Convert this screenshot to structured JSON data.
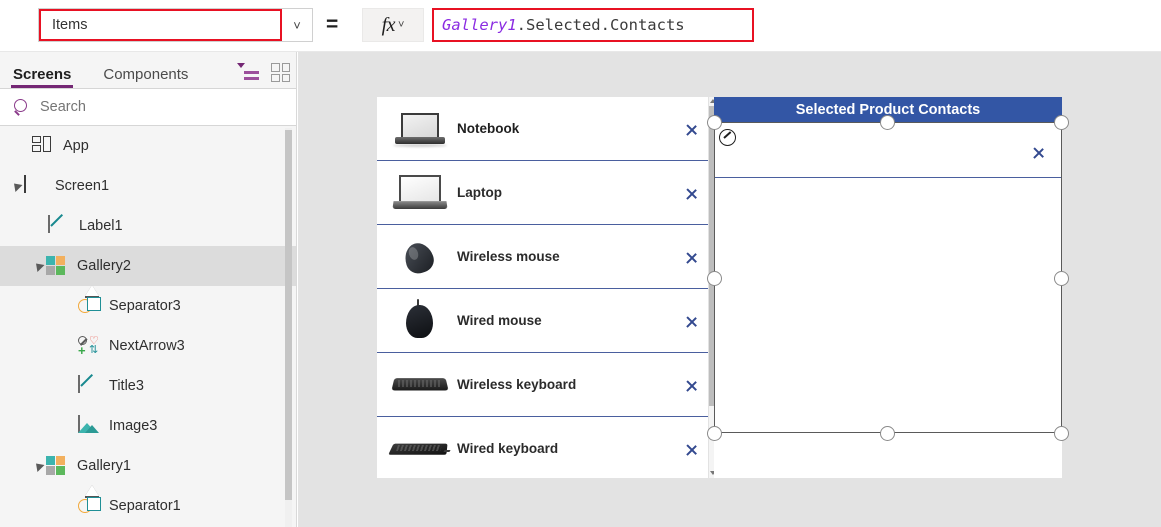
{
  "formula_bar": {
    "property_value": "Items",
    "property_caret_icon": "chevron-down-icon",
    "equals": "=",
    "fx_label": "fx",
    "fx_caret_icon": "chevron-down-icon",
    "formula_identifier": "Gallery1",
    "formula_rest": ".Selected.Contacts",
    "identifier_color": "#8a2be2",
    "highlight_border_color": "#e81123"
  },
  "sidebar": {
    "tabs": [
      {
        "label": "Screens",
        "active": true
      },
      {
        "label": "Components",
        "active": false
      }
    ],
    "view_icons": [
      {
        "name": "tree-view-icon",
        "active": true,
        "color": "#9b4f9b"
      },
      {
        "name": "thumbnail-view-icon",
        "active": false,
        "color": "#9a9a9a"
      }
    ],
    "search": {
      "placeholder": "Search",
      "icon": "search-icon"
    },
    "tree": [
      {
        "label": "App",
        "icon": "app-icon",
        "indent": 0,
        "expander": "none",
        "selected": false
      },
      {
        "label": "Screen1",
        "icon": "screen-icon",
        "indent": 0,
        "expander": "expanded",
        "selected": false
      },
      {
        "label": "Label1",
        "icon": "label-icon",
        "indent": 1,
        "expander": "none",
        "selected": false
      },
      {
        "label": "Gallery2",
        "icon": "gallery-icon",
        "indent": 1,
        "expander": "expanded",
        "selected": true
      },
      {
        "label": "Separator3",
        "icon": "separator-icon",
        "indent": 2,
        "expander": "none",
        "selected": false
      },
      {
        "label": "NextArrow3",
        "icon": "next-arrow-icon",
        "indent": 2,
        "expander": "none",
        "selected": false
      },
      {
        "label": "Title3",
        "icon": "label-icon",
        "indent": 2,
        "expander": "none",
        "selected": false
      },
      {
        "label": "Image3",
        "icon": "image-icon",
        "indent": 2,
        "expander": "none",
        "selected": false
      },
      {
        "label": "Gallery1",
        "icon": "gallery-icon",
        "indent": 1,
        "expander": "expanded",
        "selected": false
      },
      {
        "label": "Separator1",
        "icon": "separator-icon",
        "indent": 2,
        "expander": "none",
        "selected": false
      }
    ]
  },
  "canvas": {
    "background_color": "#e3e3e3",
    "gallery1": {
      "name": "product-gallery",
      "items": [
        {
          "title": "Notebook",
          "thumb": "notebook-image",
          "selected": true
        },
        {
          "title": "Laptop",
          "thumb": "laptop-image",
          "selected": false
        },
        {
          "title": "Wireless mouse",
          "thumb": "wireless-mouse-image",
          "selected": false
        },
        {
          "title": "Wired mouse",
          "thumb": "wired-mouse-image",
          "selected": false
        },
        {
          "title": "Wireless keyboard",
          "thumb": "wireless-keyboard-image",
          "selected": false
        },
        {
          "title": "Wired keyboard",
          "thumb": "wired-keyboard-image",
          "selected": false
        }
      ],
      "chevron_icon": "next-arrow-icon",
      "separator_color": "#4a5f9e"
    },
    "gallery2": {
      "name": "selected-product-contacts-gallery",
      "header_title": "Selected Product Contacts",
      "header_bg": "#3356a5",
      "header_text_color": "#ffffff",
      "chevron_icon": "next-arrow-icon",
      "rows_empty": true
    },
    "selection": {
      "edit_badge_icon": "pencil-edit-icon",
      "handle_count": 8,
      "handle_fill": "#ffffff",
      "border_color": "#5a5a5a"
    }
  }
}
